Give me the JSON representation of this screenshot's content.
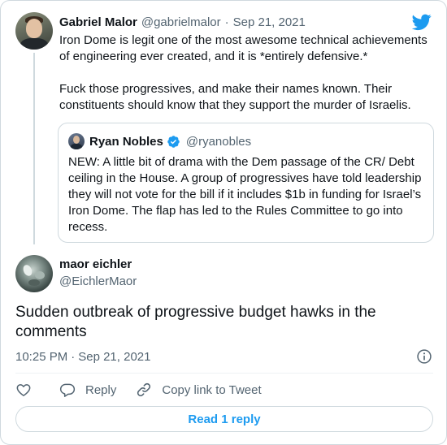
{
  "parent_tweet": {
    "display_name": "Gabriel Malor",
    "handle": "@gabrielmalor",
    "separator": "·",
    "date": "Sep 21, 2021",
    "paragraphs": [
      "Iron Dome is legit one of the most awesome technical achievements of engineering ever created, and it is *entirely defensive.*",
      "Fuck those progressives, and make their names known. Their constituents should know that they support the murder of Israelis."
    ]
  },
  "quoted_tweet": {
    "display_name": "Ryan Nobles",
    "handle": "@ryanobles",
    "verified": true,
    "text": "NEW: A little bit of drama with the Dem passage of the CR/ Debt ceiling in the House. A group of progressives have told leadership they will not vote for the bill if it includes $1b in funding for Israel’s Iron Dome. The flap has led to the Rules Committee to go into recess."
  },
  "reply_tweet": {
    "display_name": "maor eichler",
    "handle": "@EichlerMaor",
    "text": "Sudden outbreak of progressive budget hawks in the comments",
    "time": "10:25 PM",
    "separator": "·",
    "date": "Sep 21, 2021"
  },
  "actions": {
    "like_label": "",
    "reply_label": "Reply",
    "copy_link_label": "Copy link to Tweet"
  },
  "read_replies_label": "Read 1 reply",
  "icons": {
    "brand": "twitter-bird-icon",
    "verified": "verified-badge-icon",
    "info": "info-icon",
    "like": "heart-icon",
    "reply": "speech-bubble-icon",
    "copy_link": "link-icon"
  },
  "colors": {
    "brand_blue": "#1d9bf0",
    "text_primary": "#0f1419",
    "text_secondary": "#536471",
    "border": "#cfd9de"
  }
}
